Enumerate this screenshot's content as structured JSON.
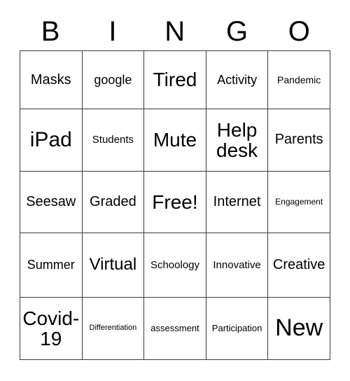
{
  "card": {
    "header_letters": [
      "B",
      "I",
      "N",
      "G",
      "O"
    ],
    "grid": {
      "rows": 5,
      "columns": 5,
      "cells": [
        [
          {
            "text": "Masks",
            "size": "sz-xl"
          },
          {
            "text": "google",
            "size": "sz-l"
          },
          {
            "text": "Tired",
            "size": "sz-h1"
          },
          {
            "text": "Activity",
            "size": "sz-l"
          },
          {
            "text": "Pandemic",
            "size": "sz-m"
          }
        ],
        [
          {
            "text": "iPad",
            "size": "sz-h2"
          },
          {
            "text": "Students",
            "size": "sz-ml"
          },
          {
            "text": "Mute",
            "size": "sz-h1"
          },
          {
            "text": "Help desk",
            "size": "sz-h1"
          },
          {
            "text": "Parents",
            "size": "sz-xl"
          }
        ],
        [
          {
            "text": "Seesaw",
            "size": "sz-xl"
          },
          {
            "text": "Graded",
            "size": "sz-xl"
          },
          {
            "text": "Free!",
            "size": "sz-h1"
          },
          {
            "text": "Internet",
            "size": "sz-xl"
          },
          {
            "text": "Engagement",
            "size": "sz-xs"
          }
        ],
        [
          {
            "text": "Summer",
            "size": "sz-l"
          },
          {
            "text": "Virtual",
            "size": "sz-xxl"
          },
          {
            "text": "Schoology",
            "size": "sz-ml"
          },
          {
            "text": "Innovative",
            "size": "sz-ml"
          },
          {
            "text": "Creative",
            "size": "sz-xl"
          }
        ],
        [
          {
            "text": "Covid-19",
            "size": "sz-h1"
          },
          {
            "text": "Differentiation",
            "size": "sz-xxs"
          },
          {
            "text": "assessment",
            "size": "sz-s"
          },
          {
            "text": "Participation",
            "size": "sz-s"
          },
          {
            "text": "New",
            "size": "sz-h3"
          }
        ]
      ]
    },
    "colors": {
      "background": "#ffffff",
      "text": "#000000",
      "grid_line": "#3a3a3a"
    }
  }
}
